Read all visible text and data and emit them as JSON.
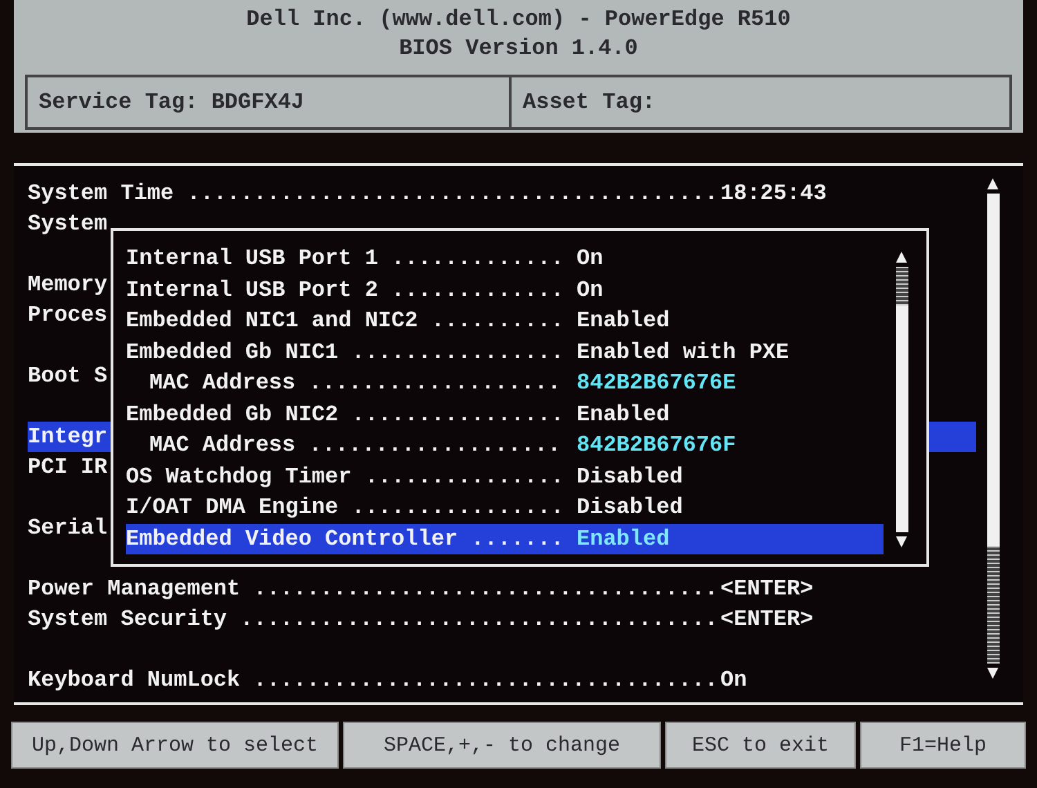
{
  "header": {
    "title": "Dell Inc. (www.dell.com) - PowerEdge R510",
    "subtitle": "BIOS Version 1.4.0",
    "service_tag": "Service Tag: BDGFX4J",
    "asset_tag": "Asset Tag:"
  },
  "settings": {
    "groups": [
      [
        {
          "label": "System Time ........................................",
          "value": "18:25:43",
          "selected": false
        },
        {
          "label": "System",
          "selected": false
        }
      ],
      [
        {
          "label": "Memory",
          "selected": false
        },
        {
          "label": "Proces",
          "selected": false
        }
      ],
      [
        {
          "label": "Boot S",
          "selected": false
        }
      ],
      [
        {
          "label": "Integr",
          "selected": true
        },
        {
          "label": "PCI IR",
          "selected": false
        }
      ],
      [
        {
          "label": "Serial",
          "selected": false
        }
      ],
      [
        {
          "label": "Power Management ...................................",
          "value": "<ENTER>",
          "selected": false
        },
        {
          "label": "System Security ....................................",
          "value": "<ENTER>",
          "selected": false
        }
      ],
      [
        {
          "label": "Keyboard NumLock ...................................",
          "value": "On",
          "selected": false
        }
      ]
    ]
  },
  "popup": {
    "items": [
      {
        "label": "Internal USB Port 1 .............",
        "value": "On",
        "kind": "option",
        "selected": false
      },
      {
        "label": "Internal USB Port 2 .............",
        "value": "On",
        "kind": "option",
        "selected": false
      },
      {
        "label": "Embedded NIC1 and NIC2 ..........",
        "value": "Enabled",
        "kind": "option",
        "selected": false
      },
      {
        "label": "Embedded Gb NIC1 ................",
        "value": "Enabled with PXE",
        "kind": "option",
        "selected": false,
        "children": [
          {
            "label": "MAC Address ...................",
            "value": "842B2B67676E",
            "kind": "address",
            "selected": false
          }
        ]
      },
      {
        "label": "Embedded Gb NIC2 ................",
        "value": "Enabled",
        "kind": "option",
        "selected": false,
        "children": [
          {
            "label": "MAC Address ...................",
            "value": "842B2B67676F",
            "kind": "address",
            "selected": false
          }
        ]
      },
      {
        "label": "OS Watchdog Timer ...............",
        "value": "Disabled",
        "kind": "option",
        "selected": false
      },
      {
        "label": "I/OAT DMA Engine ................",
        "value": "Disabled",
        "kind": "option",
        "selected": false
      },
      {
        "label": "Embedded Video Controller .......",
        "value": "Enabled",
        "kind": "option",
        "selected": true
      }
    ]
  },
  "footer": [
    "Up,Down Arrow to select",
    "SPACE,+,- to change",
    "ESC to exit",
    "F1=Help"
  ]
}
